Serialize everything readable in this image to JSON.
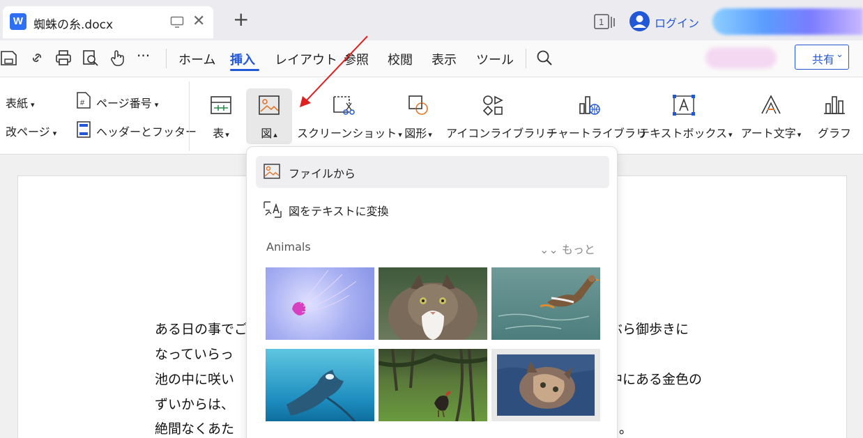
{
  "tab": {
    "icon_letter": "W",
    "name": "蜘蛛の糸.docx",
    "close": "✕",
    "add": "+"
  },
  "titlebar": {
    "login": "ログイン"
  },
  "menu": {
    "items": [
      "ホーム",
      "挿入",
      "レイアウト",
      "参照",
      "校閲",
      "表示",
      "ツール"
    ],
    "active": "挿入",
    "more": "···",
    "share_label": "共有"
  },
  "toolbar": {
    "cover": "表紙",
    "page_break": "改ページ",
    "page_number": "ページ番号",
    "header_footer": "ヘッダーとフッター",
    "table": "表",
    "picture": "図",
    "screenshot": "スクリーンショット",
    "shapes": "図形",
    "icon_library": "アイコンライブラリー",
    "chart_library": "チャートライブラリ",
    "textbox": "テキストボックス",
    "wordart": "アート文字",
    "graph": "グラフ"
  },
  "dropdown": {
    "from_file": "ファイルから",
    "image_to_text": "図をテキストに変換",
    "section": "Animals",
    "more": "もっと",
    "thumbnails": [
      "jellyfish",
      "cat",
      "goose",
      "manta-ray",
      "rooster",
      "kitten"
    ]
  },
  "document": {
    "lines": [
      {
        "left": "ある日の事でご",
        "right": "ぶら御歩きに"
      },
      {
        "left": "なっていらっ",
        "right": ""
      },
      {
        "left": "池の中に咲い",
        "right": "中にある金色の"
      },
      {
        "left": "ずいからは、",
        "right": ""
      },
      {
        "left": "絶間なくあた",
        "right": "。"
      }
    ]
  },
  "colors": {
    "accent": "#2257d6",
    "icon_orange": "#e0772a",
    "arrow": "#e02020"
  }
}
